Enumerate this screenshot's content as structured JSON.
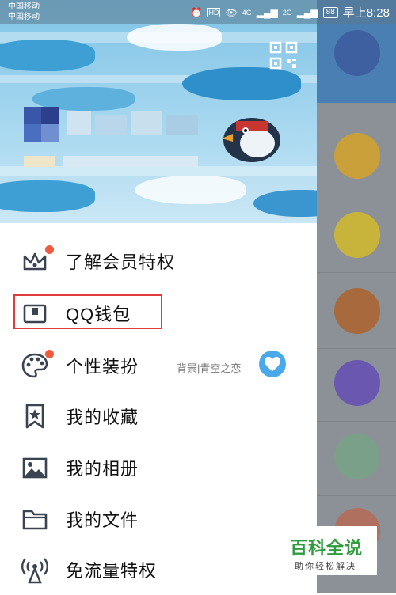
{
  "status_bar": {
    "carrier_1": "中国移动",
    "carrier_2": "中国移动",
    "network_1": "4G",
    "network_2": "2G",
    "battery": "88",
    "time": "早上8:28"
  },
  "profile": {
    "qr_icon": "qr-code-icon",
    "nickname_visible": false
  },
  "menu": {
    "items": [
      {
        "label": "了解会员特权",
        "icon": "crown-icon",
        "has_red_dot": true
      },
      {
        "label": "QQ钱包",
        "icon": "wallet-icon",
        "has_red_dot": false,
        "highlighted": true
      },
      {
        "label": "个性装扮",
        "icon": "palette-icon",
        "has_red_dot": true,
        "sub_text": "背景|青空之恋"
      },
      {
        "label": "我的收藏",
        "icon": "bookmark-star-icon",
        "has_red_dot": false
      },
      {
        "label": "我的相册",
        "icon": "image-icon",
        "has_red_dot": false
      },
      {
        "label": "我的文件",
        "icon": "folder-icon",
        "has_red_dot": false
      },
      {
        "label": "免流量特权",
        "icon": "signal-tower-icon",
        "has_red_dot": false
      }
    ]
  },
  "watermark": {
    "title": "百科全说",
    "subtitle": "助你轻松解决"
  },
  "colors": {
    "accent_red": "#e23b3b",
    "red_dot": "#f15a3a",
    "watermark_green": "#2e9c3e",
    "icon_stroke": "#3a4450"
  }
}
